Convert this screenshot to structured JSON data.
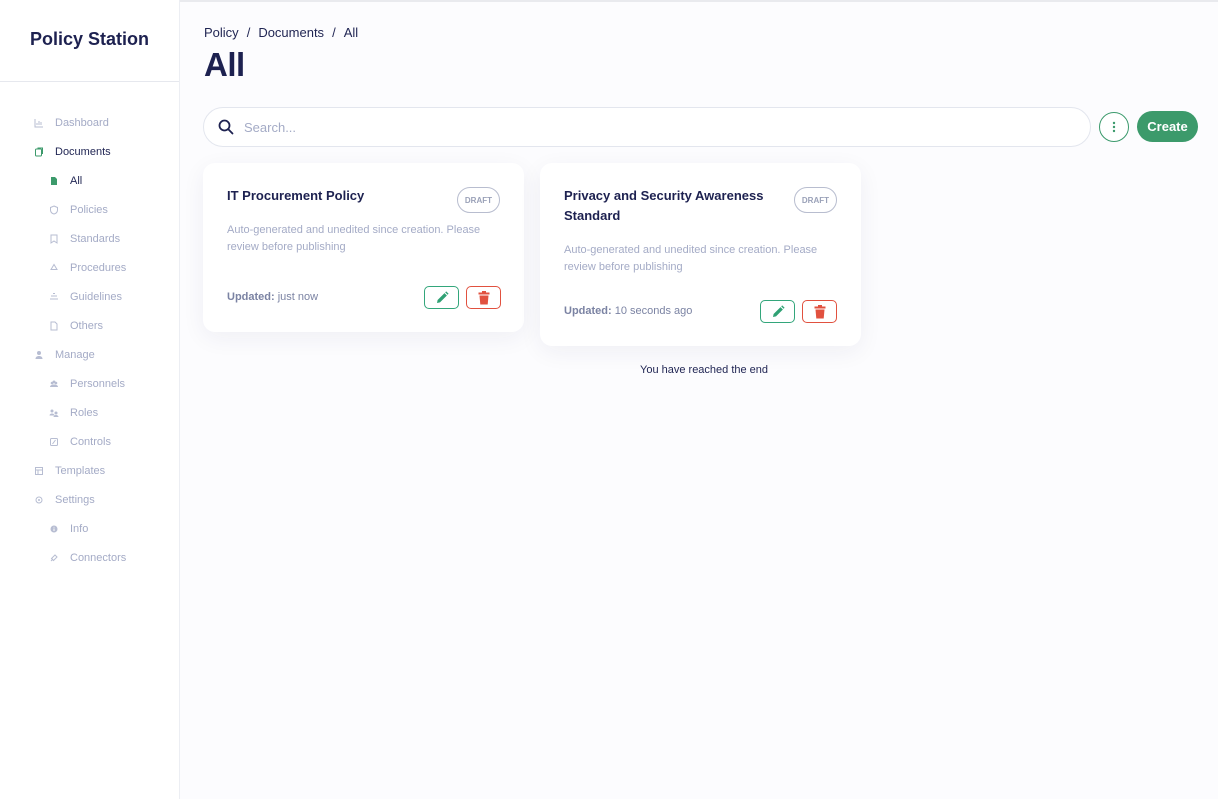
{
  "app": {
    "title": "Policy Station"
  },
  "sidebar": {
    "items": [
      {
        "label": "Dashboard",
        "icon": "chart-icon"
      },
      {
        "label": "Documents",
        "icon": "documents-icon"
      },
      {
        "label": "All",
        "icon": "file-icon"
      },
      {
        "label": "Policies",
        "icon": "shield-icon"
      },
      {
        "label": "Standards",
        "icon": "bookmark-icon"
      },
      {
        "label": "Procedures",
        "icon": "recycle-icon"
      },
      {
        "label": "Guidelines",
        "icon": "guidelines-icon"
      },
      {
        "label": "Others",
        "icon": "page-icon"
      },
      {
        "label": "Manage",
        "icon": "person-icon"
      },
      {
        "label": "Personnels",
        "icon": "group-icon"
      },
      {
        "label": "Roles",
        "icon": "roles-icon"
      },
      {
        "label": "Controls",
        "icon": "controls-icon"
      },
      {
        "label": "Templates",
        "icon": "templates-icon"
      },
      {
        "label": "Settings",
        "icon": "gear-icon"
      },
      {
        "label": "Info",
        "icon": "info-icon"
      },
      {
        "label": "Connectors",
        "icon": "plug-icon"
      }
    ]
  },
  "breadcrumb": {
    "items": [
      "Policy",
      "Documents",
      "All"
    ],
    "separator": "/"
  },
  "page": {
    "title": "All"
  },
  "search": {
    "placeholder": "Search...",
    "value": ""
  },
  "toolbar": {
    "create_label": "Create"
  },
  "documents": [
    {
      "title": "IT Procurement Policy",
      "status": "DRAFT",
      "description": "Auto-generated and unedited since creation. Please review before publishing",
      "updated_label": "Updated:",
      "updated_value": "just now"
    },
    {
      "title": "Privacy and Security Awareness Standard",
      "status": "DRAFT",
      "description": "Auto-generated and unedited since creation. Please review before publishing",
      "updated_label": "Updated:",
      "updated_value": "10 seconds ago"
    }
  ],
  "list": {
    "end_text": "You have reached the end"
  },
  "colors": {
    "accent": "#3c9a6b",
    "danger": "#e1513f",
    "text_dark": "#1d2150",
    "text_muted": "#a4abc6"
  }
}
